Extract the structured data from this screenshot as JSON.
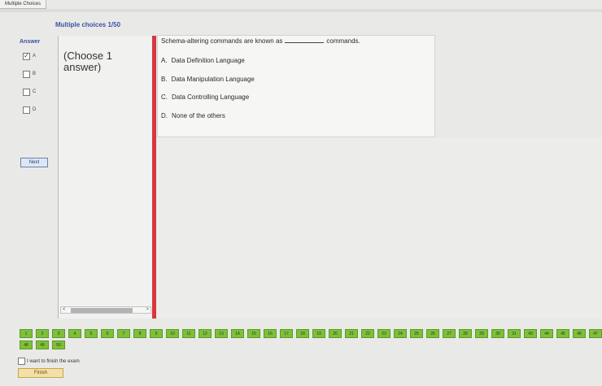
{
  "window": {
    "title": "Multiple Choices"
  },
  "header": {
    "title": "Multiple choices 1/50"
  },
  "answer_panel": {
    "label": "Answer",
    "options": [
      {
        "letter": "A",
        "checked": true
      },
      {
        "letter": "B",
        "checked": false
      },
      {
        "letter": "C",
        "checked": false
      },
      {
        "letter": "D",
        "checked": false
      }
    ],
    "next_label": "Next"
  },
  "instruction": {
    "text": "(Choose 1 answer)"
  },
  "question": {
    "prefix": "Schema-altering commands are known as",
    "suffix": "commands.",
    "answers": [
      {
        "letter": "A.",
        "text": "Data Definition Language"
      },
      {
        "letter": "B.",
        "text": "Data Manipulation Language"
      },
      {
        "letter": "C.",
        "text": "Data Controlling Language"
      },
      {
        "letter": "D.",
        "text": "None of the others"
      }
    ]
  },
  "navigation": {
    "question_numbers": [
      "1",
      "2",
      "3",
      "4",
      "5",
      "6",
      "7",
      "8",
      "9",
      "10",
      "11",
      "12",
      "13",
      "14",
      "15",
      "16",
      "17",
      "18",
      "19",
      "20",
      "21",
      "22",
      "23",
      "24",
      "25",
      "26",
      "27",
      "28",
      "29",
      "30",
      "31",
      "43",
      "44",
      "45",
      "46",
      "47",
      "48",
      "49",
      "50"
    ]
  },
  "finish": {
    "checkbox_label": "I want to finish the exam",
    "checked": false,
    "button_label": "Finish"
  }
}
